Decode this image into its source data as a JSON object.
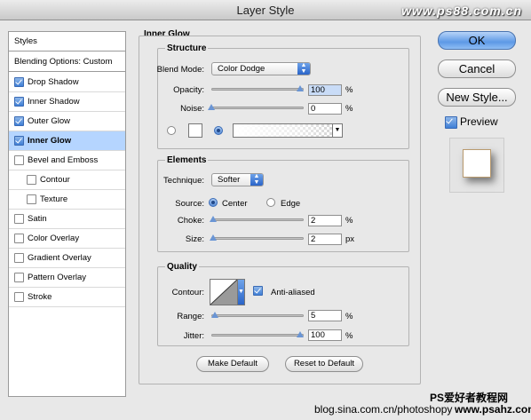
{
  "window": {
    "title": "Layer Style",
    "watermark_top": "www.ps88.com.cn"
  },
  "sidebar": {
    "styles_label": "Styles",
    "blending_label": "Blending Options: Custom",
    "items": [
      {
        "label": "Drop Shadow",
        "checked": true
      },
      {
        "label": "Inner Shadow",
        "checked": true
      },
      {
        "label": "Outer Glow",
        "checked": true
      },
      {
        "label": "Inner Glow",
        "checked": true,
        "selected": true
      },
      {
        "label": "Bevel and Emboss",
        "checked": false
      },
      {
        "label": "Contour",
        "checked": false,
        "indent": true
      },
      {
        "label": "Texture",
        "checked": false,
        "indent": true
      },
      {
        "label": "Satin",
        "checked": false
      },
      {
        "label": "Color Overlay",
        "checked": false
      },
      {
        "label": "Gradient Overlay",
        "checked": false
      },
      {
        "label": "Pattern Overlay",
        "checked": false
      },
      {
        "label": "Stroke",
        "checked": false
      }
    ]
  },
  "panel": {
    "title": "Inner Glow",
    "structure": {
      "title": "Structure",
      "blend_mode_label": "Blend Mode:",
      "blend_mode": "Color Dodge",
      "opacity_label": "Opacity:",
      "opacity": "100",
      "opacity_unit": "%",
      "noise_label": "Noise:",
      "noise": "0",
      "noise_unit": "%"
    },
    "elements": {
      "title": "Elements",
      "technique_label": "Technique:",
      "technique": "Softer",
      "source_label": "Source:",
      "source_center": "Center",
      "source_edge": "Edge",
      "choke_label": "Choke:",
      "choke": "2",
      "choke_unit": "%",
      "size_label": "Size:",
      "size": "2",
      "size_unit": "px"
    },
    "quality": {
      "title": "Quality",
      "contour_label": "Contour:",
      "antialiased_label": "Anti-aliased",
      "range_label": "Range:",
      "range": "5",
      "range_unit": "%",
      "jitter_label": "Jitter:",
      "jitter": "100",
      "jitter_unit": "%"
    },
    "make_default": "Make Default",
    "reset_default": "Reset to Default"
  },
  "buttons": {
    "ok": "OK",
    "cancel": "Cancel",
    "new_style": "New Style...",
    "preview": "Preview"
  },
  "footer": {
    "watermark_1": "PS爱好者教程网",
    "watermark_2": "blog.sina.com.cn/photoshopy",
    "watermark_3": "www.psahz.com"
  }
}
